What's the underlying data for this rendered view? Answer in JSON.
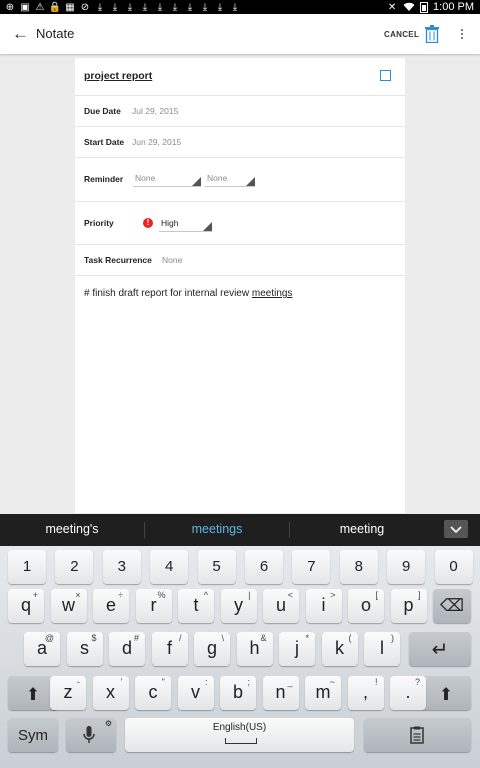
{
  "status_bar": {
    "time": "1:00 PM",
    "left_icons": [
      "add-icon",
      "image-icon",
      "warning-icon",
      "lock-icon",
      "calendar-icon",
      "no-sim-icon",
      "download-icon",
      "download-icon",
      "download-icon",
      "download-icon",
      "download-icon",
      "download-icon",
      "download-icon",
      "download-icon",
      "download-icon",
      "download-icon"
    ],
    "right_icons": [
      "close-notification-icon",
      "wifi-icon",
      "battery-icon"
    ]
  },
  "app_bar": {
    "back_label": "←",
    "title": "Notate",
    "cancel_label": "CANCEL"
  },
  "task": {
    "title": "project report",
    "due_date_label": "Due Date",
    "due_date_value": "Jul 29, 2015",
    "start_date_label": "Start Date",
    "start_date_value": "Jun 29, 2015",
    "reminder_label": "Reminder",
    "reminder_value_1": "None",
    "reminder_value_2": "None",
    "priority_label": "Priority",
    "priority_icon_glyph": "!",
    "priority_value": "High",
    "recurrence_label": "Task Recurrence",
    "recurrence_value": "None",
    "note_prefix": "# finish draft report for internal review ",
    "note_underlined": "meetings"
  },
  "suggestions": [
    "meeting's",
    "meetings",
    "meeting"
  ],
  "keyboard": {
    "numbers": [
      "1",
      "2",
      "3",
      "4",
      "5",
      "6",
      "7",
      "8",
      "9",
      "0"
    ],
    "row1": [
      {
        "k": "q",
        "s": "+"
      },
      {
        "k": "w",
        "s": "×"
      },
      {
        "k": "e",
        "s": "÷"
      },
      {
        "k": "r",
        "s": "%"
      },
      {
        "k": "t",
        "s": "^"
      },
      {
        "k": "y",
        "s": "|"
      },
      {
        "k": "u",
        "s": "<"
      },
      {
        "k": "i",
        "s": ">"
      },
      {
        "k": "o",
        "s": "["
      },
      {
        "k": "p",
        "s": "]"
      }
    ],
    "row2": [
      {
        "k": "a",
        "s": "@"
      },
      {
        "k": "s",
        "s": "$"
      },
      {
        "k": "d",
        "s": "#"
      },
      {
        "k": "f",
        "s": "/"
      },
      {
        "k": "g",
        "s": "\\"
      },
      {
        "k": "h",
        "s": "&"
      },
      {
        "k": "j",
        "s": "*"
      },
      {
        "k": "k",
        "s": "("
      },
      {
        "k": "l",
        "s": ")"
      }
    ],
    "row3": [
      {
        "k": "z",
        "s": "-"
      },
      {
        "k": "x",
        "s": "'"
      },
      {
        "k": "c",
        "s": "\""
      },
      {
        "k": "v",
        "s": ":"
      },
      {
        "k": "b",
        "s": ";"
      },
      {
        "k": "n",
        "s": "_"
      },
      {
        "k": "m",
        "s": "~"
      },
      {
        "k": ",",
        "s": "!"
      },
      {
        "k": ".",
        "s": "?"
      }
    ],
    "sym_label": "Sym",
    "space_label": "English(US)",
    "enter_glyph": "↵",
    "shift_glyph": "⬆",
    "backspace_glyph": "⌫",
    "mic_glyph": "🎤",
    "clipboard_glyph": "📋"
  }
}
